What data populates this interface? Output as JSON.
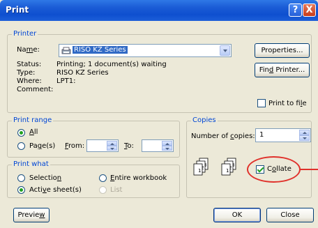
{
  "title": "Print",
  "title_buttons": {
    "help": "?",
    "close": "X"
  },
  "printer": {
    "legend": "Printer",
    "name_label": "Name:",
    "name_value": "RISO KZ Series",
    "status_label": "Status:",
    "status_value": "Printing; 1 document(s) waiting",
    "type_label": "Type:",
    "type_value": "RISO KZ Series",
    "where_label": "Where:",
    "where_value": "LPT1:",
    "comment_label": "Comment:",
    "properties_button": "Properties...",
    "find_printer_button": "Find Printer...",
    "print_to_file_label": "Print to file",
    "print_to_file_checked": false
  },
  "print_range": {
    "legend": "Print range",
    "all_label": "All",
    "pages_label": "Page(s)",
    "from_label": "From:",
    "to_label": "To:",
    "from_value": "",
    "to_value": "",
    "selected": "all"
  },
  "copies": {
    "legend": "Copies",
    "number_label": "Number of copies:",
    "number_value": "1",
    "collate_label": "Collate",
    "collate_checked": true
  },
  "print_what": {
    "legend": "Print what",
    "selection_label": "Selection",
    "entire_workbook_label": "Entire workbook",
    "active_sheets_label": "Active sheet(s)",
    "list_label": "List",
    "selected": "active_sheets"
  },
  "buttons": {
    "preview": "Preview",
    "ok": "OK",
    "close": "Close"
  },
  "colors": {
    "legend": "#0046d5",
    "highlight": "#e0312b",
    "titlebar": "#0e4fcf"
  }
}
